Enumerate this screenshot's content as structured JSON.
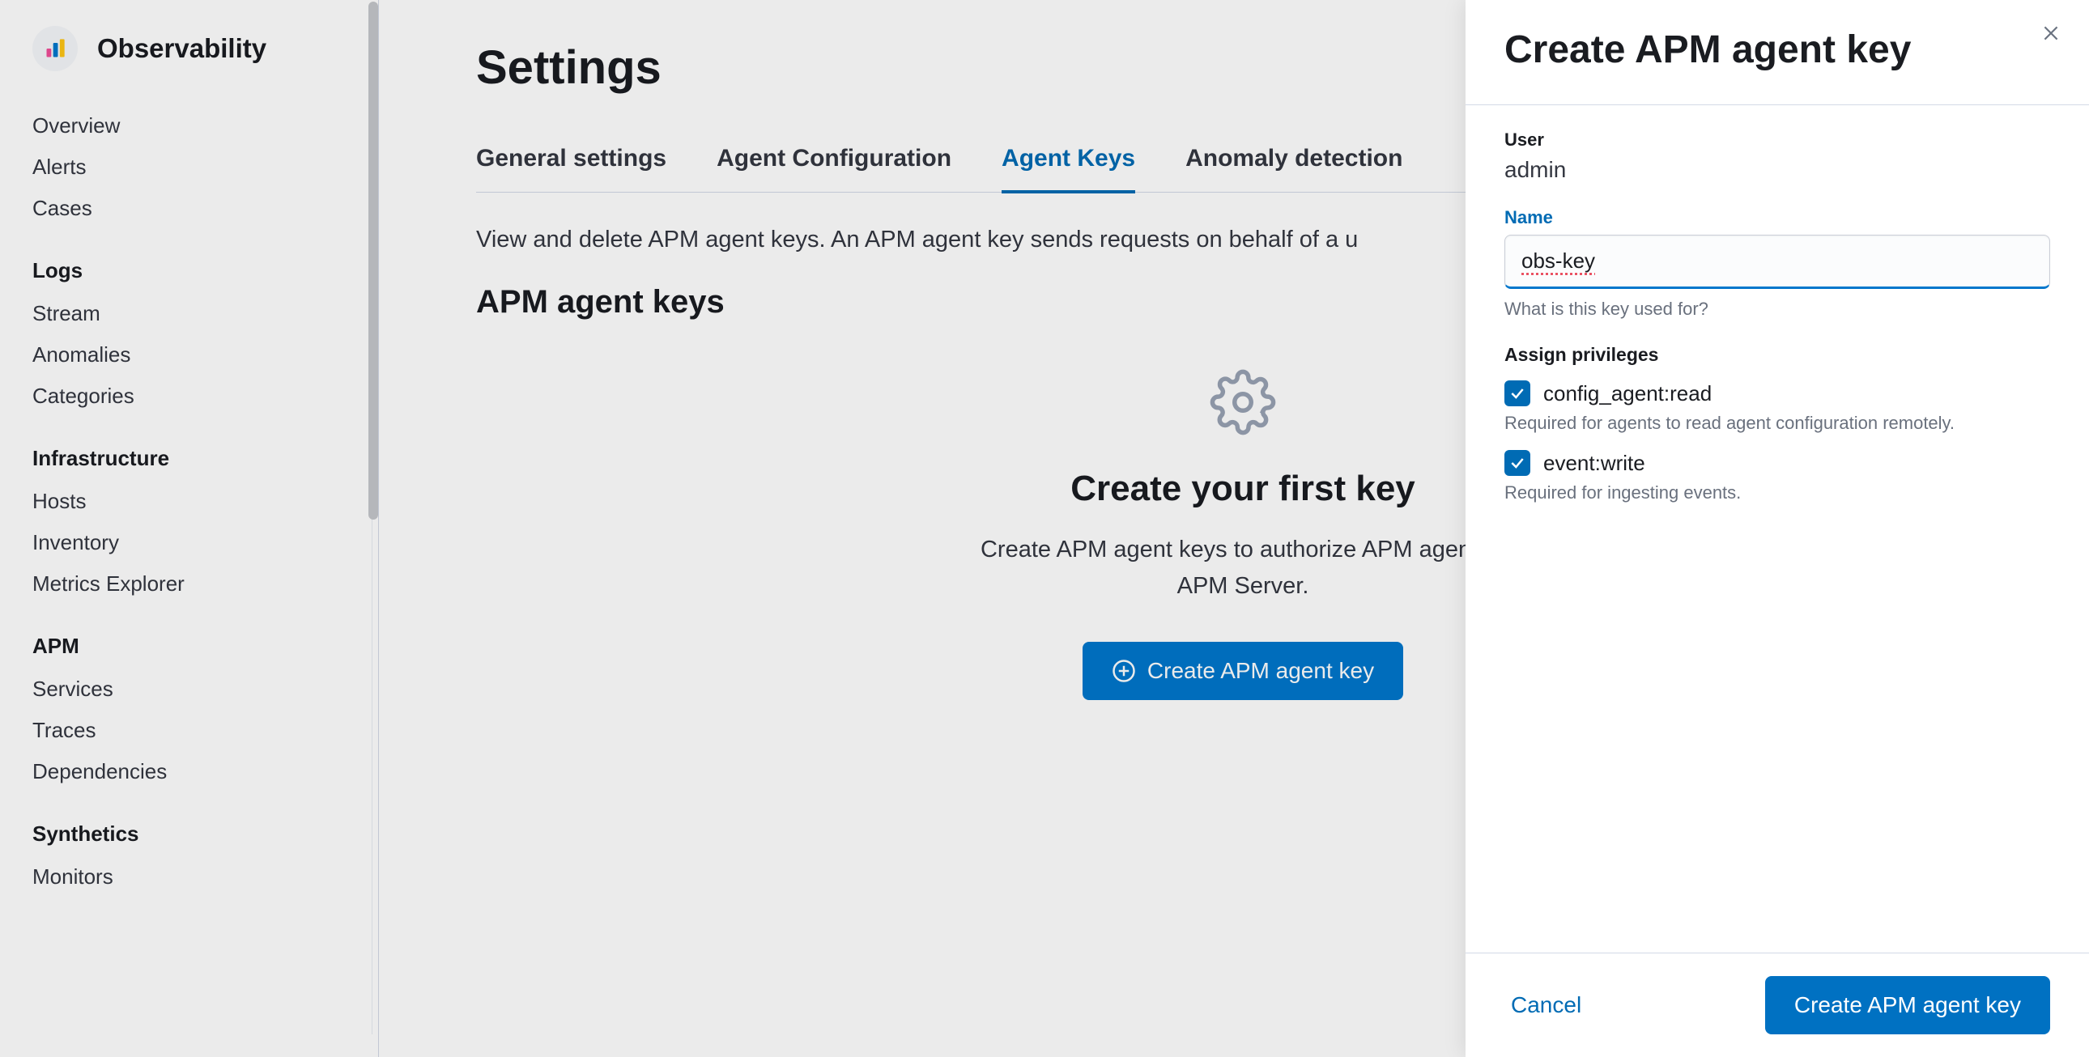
{
  "sidebar": {
    "brand": "Observability",
    "top_items": [
      "Overview",
      "Alerts",
      "Cases"
    ],
    "groups": [
      {
        "heading": "Logs",
        "items": [
          "Stream",
          "Anomalies",
          "Categories"
        ]
      },
      {
        "heading": "Infrastructure",
        "items": [
          "Hosts",
          "Inventory",
          "Metrics Explorer"
        ]
      },
      {
        "heading": "APM",
        "items": [
          "Services",
          "Traces",
          "Dependencies"
        ]
      },
      {
        "heading": "Synthetics",
        "items": [
          "Monitors"
        ]
      }
    ]
  },
  "main": {
    "title": "Settings",
    "tabs": [
      "General settings",
      "Agent Configuration",
      "Agent Keys",
      "Anomaly detection"
    ],
    "active_tab": 2,
    "description": "View and delete APM agent keys. An APM agent key sends requests on behalf of a u",
    "section_title": "APM agent keys",
    "empty": {
      "title": "Create your first key",
      "desc_line1": "Create APM agent keys to authorize APM agent re",
      "desc_line2": "APM Server.",
      "button": "Create APM agent key"
    }
  },
  "flyout": {
    "title": "Create APM agent key",
    "user_label": "User",
    "user_value": "admin",
    "name_label": "Name",
    "name_value": "obs-key",
    "name_help": "What is this key used for?",
    "privileges_label": "Assign privileges",
    "privileges": [
      {
        "name": "config_agent:read",
        "desc": "Required for agents to read agent configuration remotely.",
        "checked": true
      },
      {
        "name": "event:write",
        "desc": "Required for ingesting events.",
        "checked": true
      }
    ],
    "footer": {
      "cancel": "Cancel",
      "submit": "Create APM agent key"
    }
  }
}
